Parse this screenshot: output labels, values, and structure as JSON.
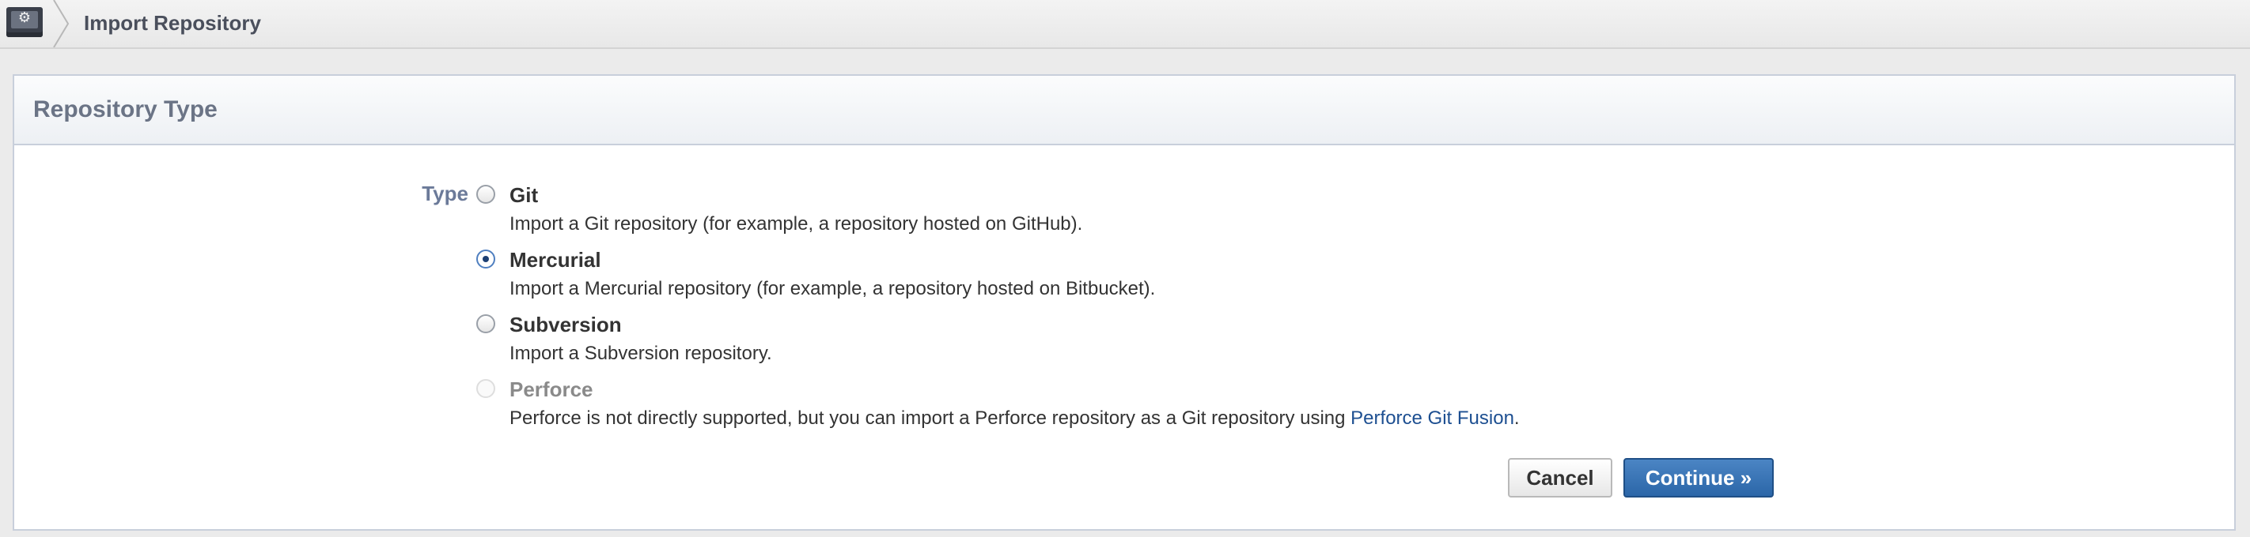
{
  "breadcrumb": {
    "app_icon": "gear-icon",
    "title": "Import Repository"
  },
  "panel": {
    "title": "Repository Type"
  },
  "form": {
    "type_label": "Type",
    "selected": "Mercurial",
    "options": [
      {
        "name": "Git",
        "description": "Import a Git repository (for example, a repository hosted on GitHub).",
        "checked": false,
        "disabled": false
      },
      {
        "name": "Mercurial",
        "description": "Import a Mercurial repository (for example, a repository hosted on Bitbucket).",
        "checked": true,
        "disabled": false
      },
      {
        "name": "Subversion",
        "description": "Import a Subversion repository.",
        "checked": false,
        "disabled": false
      },
      {
        "name": "Perforce",
        "description": "Perforce is not directly supported, but you can import a Perforce repository as a Git repository using ",
        "link_text": "Perforce Git Fusion",
        "description_suffix": ".",
        "checked": false,
        "disabled": true
      }
    ]
  },
  "buttons": {
    "cancel_label": "Cancel",
    "continue_label": "Continue »"
  },
  "colors": {
    "link": "#1d4f91",
    "primary_button": "#2b66a8",
    "panel_border": "#c8cfdb",
    "label": "#6b7a99"
  }
}
